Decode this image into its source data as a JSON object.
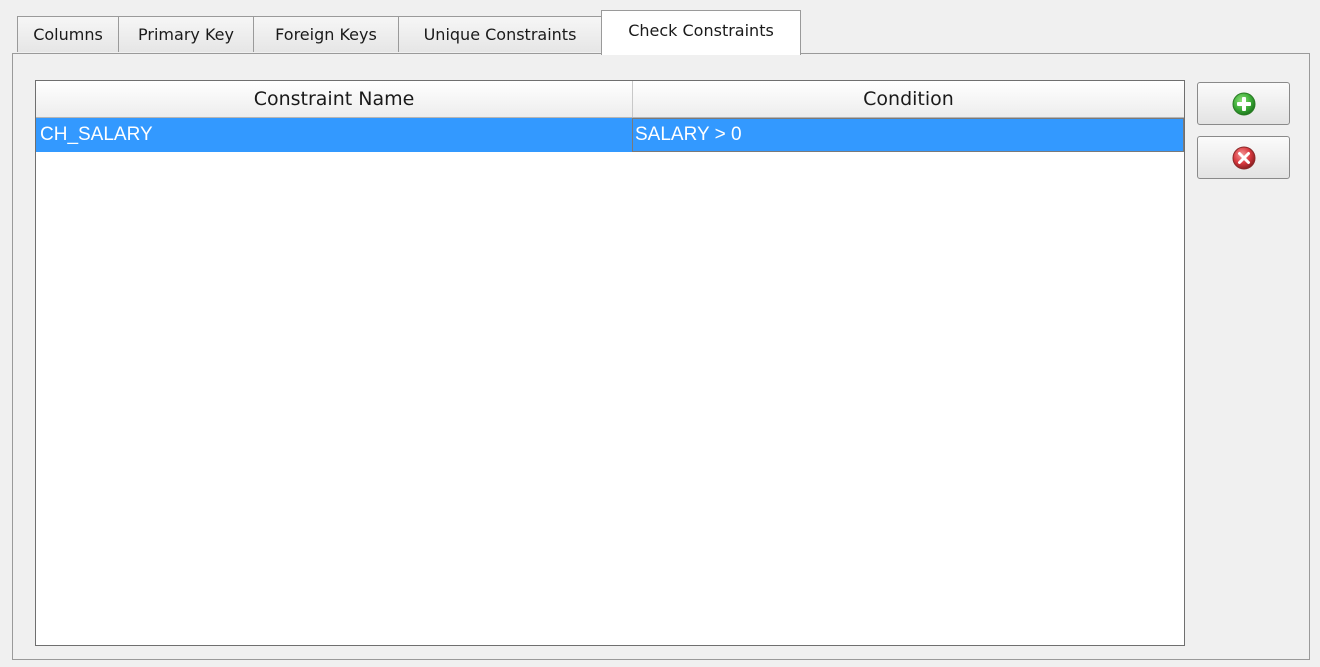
{
  "tabs": [
    {
      "label": "Columns"
    },
    {
      "label": "Primary Key"
    },
    {
      "label": "Foreign Keys"
    },
    {
      "label": "Unique Constraints"
    },
    {
      "label": "Check Constraints",
      "active": true
    }
  ],
  "table": {
    "columns": [
      "Constraint Name",
      "Condition"
    ],
    "rows": [
      {
        "name": "CH_SALARY",
        "condition": "SALARY > 0",
        "selected": true
      }
    ]
  },
  "buttons": {
    "add_icon": "add-icon",
    "delete_icon": "delete-icon"
  },
  "colors": {
    "selection": "#3399ff",
    "add_green": "#3fae3a",
    "delete_red": "#d9393f"
  }
}
